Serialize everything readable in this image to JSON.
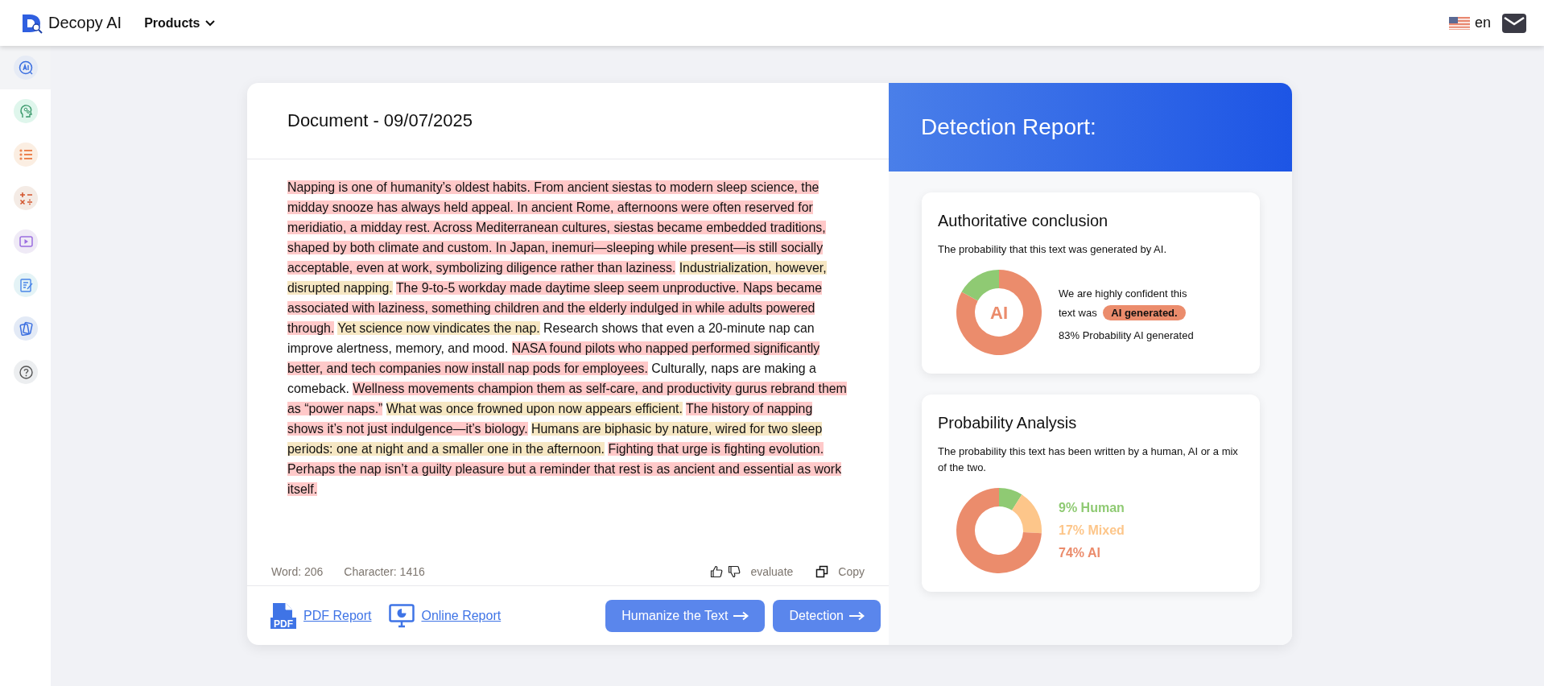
{
  "header": {
    "logo_text": "Decopy AI",
    "products_menu": "Products",
    "language": "en"
  },
  "sidebar": {
    "items": [
      {
        "kind": "ai-detector",
        "selected": true
      },
      {
        "kind": "head",
        "selected": false
      },
      {
        "kind": "list",
        "selected": false
      },
      {
        "kind": "math",
        "selected": false
      },
      {
        "kind": "video",
        "selected": false
      },
      {
        "kind": "notes",
        "selected": false
      },
      {
        "kind": "cards",
        "selected": false
      },
      {
        "kind": "help",
        "selected": false
      }
    ]
  },
  "document": {
    "title": "Document - 09/07/2025",
    "segments": [
      {
        "kind": "ai",
        "text": "Napping is one of humanity’s oldest habits. From ancient siestas to modern sleep science, the midday snooze has always held appeal. In ancient Rome, afternoons were often reserved for meridiatio, a midday rest. Across Mediterranean cultures, siestas became embedded traditions, shaped by both climate and custom. In Japan, inemuri—sleeping while present—is still socially acceptable, even at work, symbolizing diligence rather than laziness."
      },
      {
        "kind": "mixed",
        "text": "Industrialization, however, disrupted napping."
      },
      {
        "kind": "ai",
        "text": "The 9-to-5 workday made daytime sleep seem unproductive. Naps became associated with laziness, something children and the elderly indulged in while adults powered through."
      },
      {
        "kind": "mixed",
        "text": "Yet science now vindicates the nap."
      },
      {
        "kind": "human",
        "text": "Research shows that even a 20-minute nap can improve alertness, memory, and mood."
      },
      {
        "kind": "ai",
        "text": "NASA found pilots who napped performed significantly better, and tech companies now install nap pods for employees."
      },
      {
        "kind": "human",
        "text": "Culturally, naps are making a comeback."
      },
      {
        "kind": "ai",
        "text": "Wellness movements champion them as self-care, and productivity gurus rebrand them as “power naps.”"
      },
      {
        "kind": "mixed",
        "text": "What was once frowned upon now appears efficient."
      },
      {
        "kind": "ai",
        "text": "The history of napping shows it’s not just indulgence—it’s biology."
      },
      {
        "kind": "mixed",
        "text": "Humans are biphasic by nature, wired for two sleep periods: one at night and a smaller one in the afternoon."
      },
      {
        "kind": "ai",
        "text": "Fighting that urge is fighting evolution. Perhaps the nap isn’t a guilty pleasure but a reminder that rest is as ancient and essential as work itself."
      }
    ],
    "word_count": "Word: 206",
    "char_count": "Character: 1416",
    "evaluate": "evaluate",
    "copy": "Copy",
    "pdf_icon_label": "PDF",
    "pdf_report": "PDF Report",
    "online_report": "Online Report",
    "buttons": [
      "Humanize the Text",
      "Detection"
    ]
  },
  "report": {
    "title": "Detection Report:",
    "conclusion": {
      "title": "Authoritative conclusion",
      "description": "The probability that this text was generated by AI.",
      "chart_data": {
        "type": "donut",
        "colors": [
          "#eb8c6c",
          "#8fca73"
        ],
        "values": [
          83,
          17
        ]
      },
      "center_label": "AI",
      "confidence_text": "We are highly confident this text was",
      "verdict": "AI generated.",
      "probability_text": "83% Probability AI generated"
    },
    "analysis": {
      "title": "Probability Analysis",
      "description": "The probability this text has been written by a human, AI or a mix of the two.",
      "chart_data": {
        "type": "donut",
        "colors": [
          "#8fca73",
          "#fdc68a",
          "#eb8c6c"
        ],
        "values": [
          9,
          17,
          74
        ]
      },
      "legend": [
        {
          "label": "9% Human",
          "color": "#8fca73"
        },
        {
          "label": "17% Mixed",
          "color": "#fdc68a"
        },
        {
          "label": "74% AI",
          "color": "#eb8c6c"
        }
      ]
    }
  }
}
